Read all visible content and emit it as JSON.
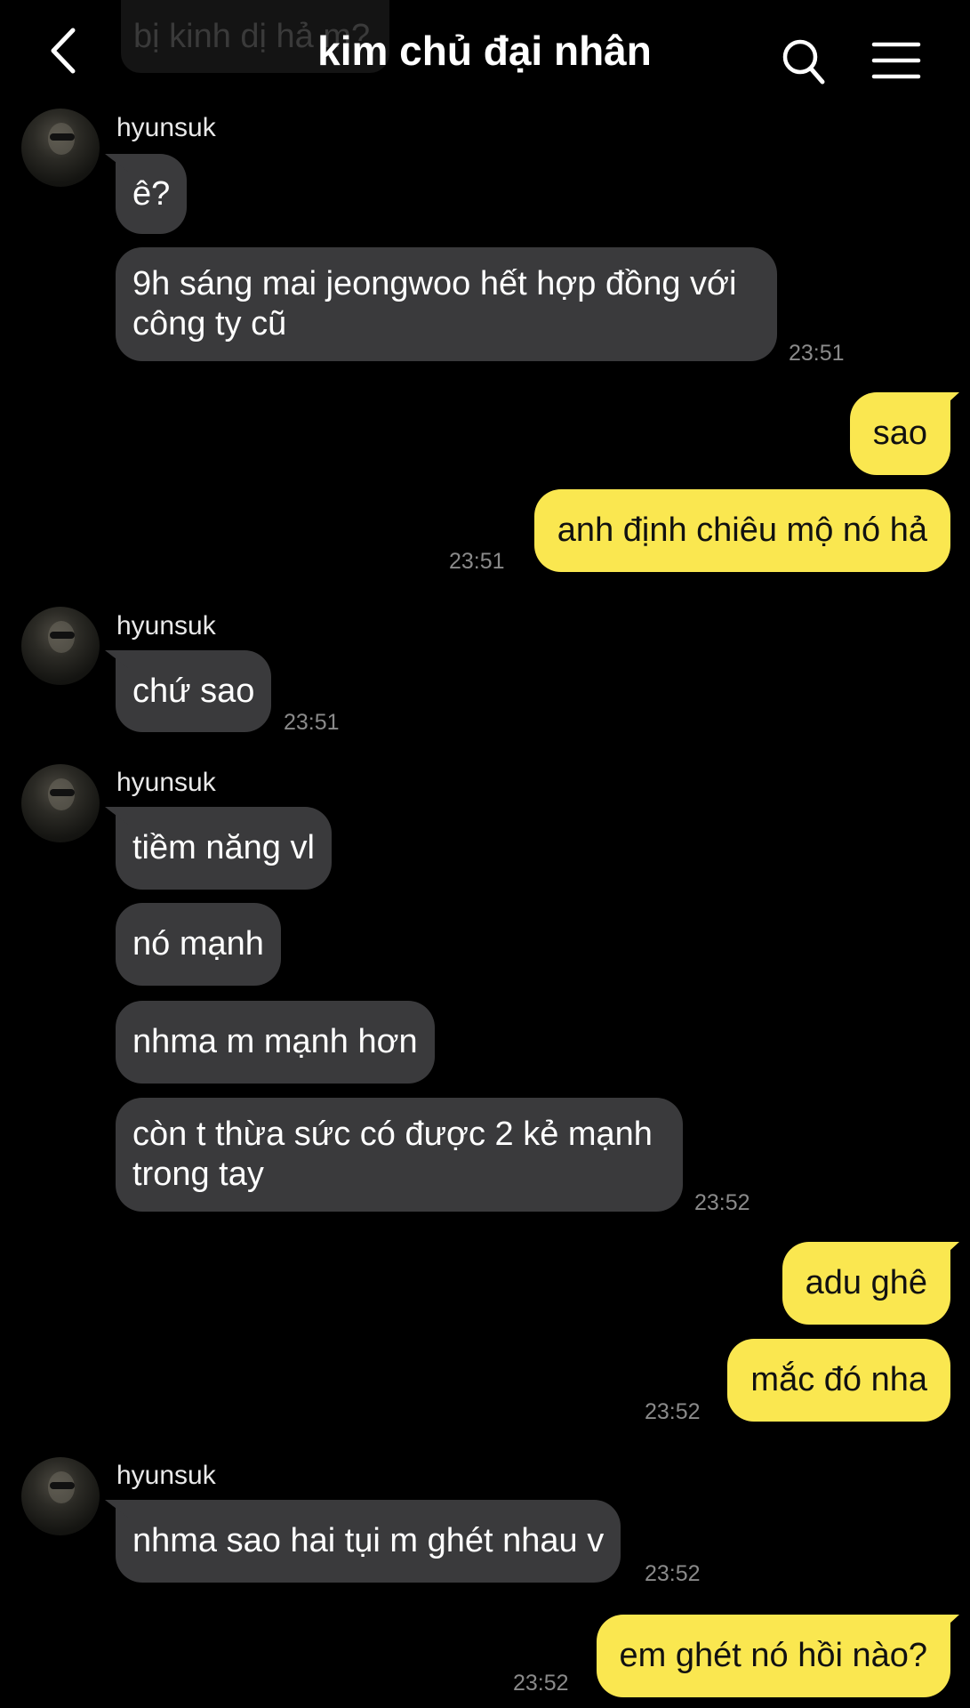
{
  "header": {
    "title": "kim chủ đại nhân",
    "prev_message": "bị kinh dị hả m?"
  },
  "messages": [
    {
      "sender": "hyunsuk",
      "text": "ê?"
    },
    {
      "text": "9h sáng mai jeongwoo hết hợp đồng với công ty cũ",
      "lines": [
        "9h sáng mai jeongwoo hết hợp đồng với",
        "công ty cũ"
      ],
      "time": "23:51"
    },
    {
      "text": "sao"
    },
    {
      "text": "anh định chiêu mộ nó hả",
      "time": "23:51"
    },
    {
      "sender": "hyunsuk",
      "text": "chứ sao",
      "time": "23:51"
    },
    {
      "sender": "hyunsuk",
      "text": "tiềm năng vl"
    },
    {
      "text": "nó mạnh"
    },
    {
      "text": "nhma m mạnh hơn"
    },
    {
      "text": "còn t thừa sức có được 2 kẻ mạnh trong tay",
      "lines": [
        "còn t thừa sức có được 2 kẻ mạnh",
        "trong tay"
      ],
      "time": "23:52"
    },
    {
      "text": "adu ghê"
    },
    {
      "text": "mắc đó nha",
      "time": "23:52"
    },
    {
      "sender": "hyunsuk",
      "text": "nhma sao hai tụi m ghét nhau v",
      "time": "23:52"
    },
    {
      "text": "em ghét nó hồi nào?",
      "time": "23:52"
    }
  ]
}
